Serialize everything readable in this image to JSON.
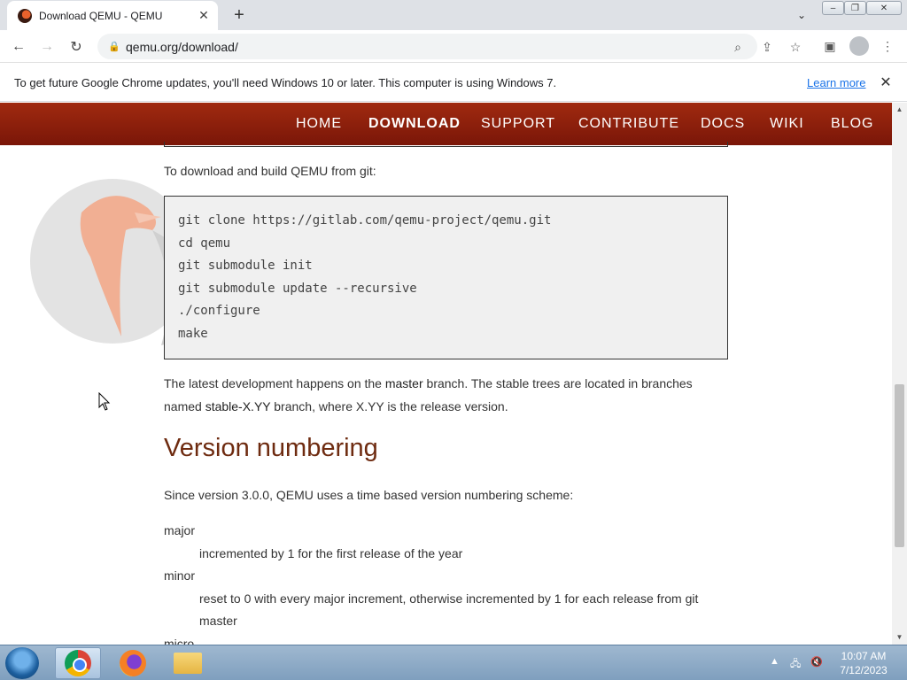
{
  "browser": {
    "tab_title": "Download QEMU - QEMU",
    "tab_close": "✕",
    "new_tab": "+",
    "url": "qemu.org/download/"
  },
  "infobar": {
    "message": "To get future Google Chrome updates, you'll need Windows 10 or later. This computer is using Windows 7.",
    "link": "Learn more",
    "close": "✕"
  },
  "site_nav": {
    "items": [
      "HOME",
      "DOWNLOAD",
      "SUPPORT",
      "CONTRIBUTE",
      "DOCS",
      "WIKI",
      "BLOG"
    ]
  },
  "content": {
    "git_intro": "To download and build QEMU from git:",
    "code_lines": [
      "git clone https://gitlab.com/qemu-project/qemu.git",
      "cd qemu",
      "git submodule init",
      "git submodule update --recursive",
      "./configure",
      "make"
    ],
    "latest_p1": "The latest development happens on the ",
    "latest_b1": "master",
    "latest_p2": " branch. The stable trees are located in branches",
    "latest_p3": "named ",
    "latest_b2": "stable-X.YY",
    "latest_p4": " branch, where X.YY is the release version.",
    "version_heading": "Version numbering",
    "version_intro": "Since version 3.0.0, QEMU uses a time based version numbering scheme:",
    "major_term": "major",
    "major_desc": "incremented by 1 for the first release of the year",
    "minor_term": "minor",
    "minor_desc_1": "reset to 0 with every major increment, otherwise incremented by 1 for each release from git",
    "minor_desc_2": "master",
    "micro_term": "micro"
  },
  "taskbar": {
    "time": "10:07 AM",
    "date": "7/12/2023"
  },
  "colors": {
    "nav_bg": "#8b1e0c",
    "heading": "#6e2b10",
    "link": "#1a73e8"
  }
}
